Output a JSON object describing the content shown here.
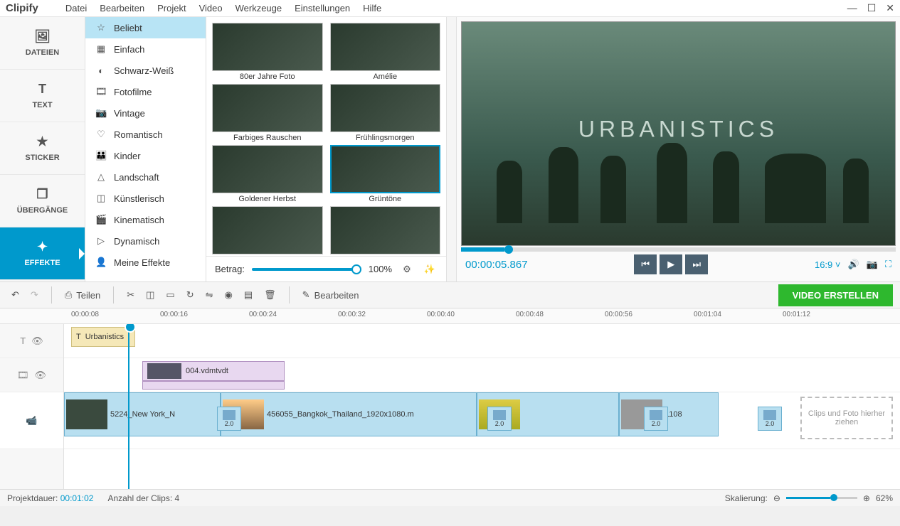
{
  "app": {
    "logo_a": "Clip",
    "logo_b": "ify"
  },
  "menu": [
    "Datei",
    "Bearbeiten",
    "Projekt",
    "Video",
    "Werkzeuge",
    "Einstellungen",
    "Hilfe"
  ],
  "left_tabs": [
    {
      "label": "DATEIEN",
      "icon": "🖼"
    },
    {
      "label": "TEXT",
      "icon": "T"
    },
    {
      "label": "STICKER",
      "icon": "★"
    },
    {
      "label": "ÜBERGÄNGE",
      "icon": "❐"
    },
    {
      "label": "EFFEKTE",
      "icon": "✦"
    }
  ],
  "active_left_tab": 4,
  "categories": [
    {
      "label": "Beliebt",
      "icon": "☆"
    },
    {
      "label": "Einfach",
      "icon": "▦"
    },
    {
      "label": "Schwarz-Weiß",
      "icon": "◐"
    },
    {
      "label": "Fotofilme",
      "icon": "🎞"
    },
    {
      "label": "Vintage",
      "icon": "📷"
    },
    {
      "label": "Romantisch",
      "icon": "♡"
    },
    {
      "label": "Kinder",
      "icon": "👶"
    },
    {
      "label": "Landschaft",
      "icon": "△"
    },
    {
      "label": "Künstlerisch",
      "icon": "◫"
    },
    {
      "label": "Kinematisch",
      "icon": "🎬"
    },
    {
      "label": "Dynamisch",
      "icon": "▷"
    },
    {
      "label": "Meine Effekte",
      "icon": "👤"
    }
  ],
  "active_category": 0,
  "effects": [
    {
      "label": "80er Jahre Foto"
    },
    {
      "label": "Amélie"
    },
    {
      "label": "Farbiges Rauschen"
    },
    {
      "label": "Frühlingsmorgen"
    },
    {
      "label": "Goldener Herbst"
    },
    {
      "label": "Grüntöne"
    },
    {
      "label": ""
    },
    {
      "label": ""
    }
  ],
  "selected_effect": 5,
  "amount": {
    "label": "Betrag:",
    "value": "100%"
  },
  "preview": {
    "overlay_text": "URBANISTICS",
    "timecode": "00:00:05.867",
    "aspect": "16:9"
  },
  "toolbar": {
    "split": "Teilen",
    "edit": "Bearbeiten",
    "create": "VIDEO ERSTELLEN"
  },
  "ruler_ticks": [
    "00:00:08",
    "00:00:16",
    "00:00:24",
    "00:00:32",
    "00:00:40",
    "00:00:48",
    "00:00:56",
    "00:01:04",
    "00:01:12"
  ],
  "timeline": {
    "text_clip": "Urbanistics",
    "video2_clip": "004.vdmtvdt",
    "main_clips": [
      {
        "label": "5224_New York_N",
        "trans": "2.0"
      },
      {
        "label": "456055_Bangkok_Thailand_1920x1080.m",
        "trans": "2.0"
      },
      {
        "label": "",
        "trans": "2.0"
      },
      {
        "label": "1108",
        "trans": "2.0"
      }
    ],
    "dropzone": "Clips und Foto hierher ziehen"
  },
  "status": {
    "duration_label": "Projektdauer:",
    "duration_value": "00:01:02",
    "clips_label": "Anzahl der Clips:",
    "clips_value": "4",
    "zoom_label": "Skalierung:",
    "zoom_value": "62%"
  }
}
